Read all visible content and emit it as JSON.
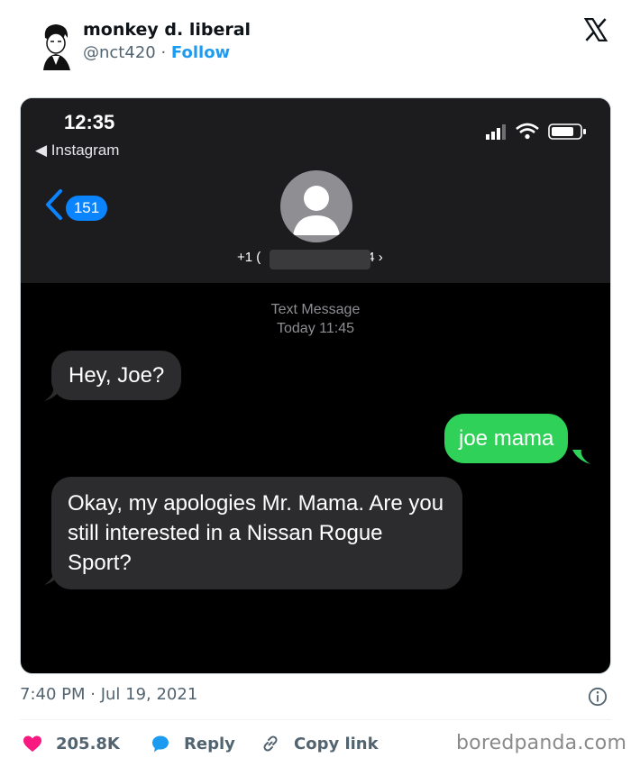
{
  "tweet": {
    "author": {
      "name": "monkey d. liberal",
      "handle": "@nct420",
      "separator": "·",
      "follow_label": "Follow"
    },
    "timestamp": "7:40 PM · Jul 19, 2021",
    "actions": {
      "likes": "205.8K",
      "reply_label": "Reply",
      "copy_label": "Copy link"
    },
    "colors": {
      "like": "#f91880",
      "accent": "#1d9bf0"
    }
  },
  "screenshot": {
    "status_time": "12:35",
    "back_app": "◀ Instagram",
    "unread_count": "151",
    "contact_number_prefix": "+1 (",
    "contact_number_suffix": "4 ›",
    "thread_label": "Text Message",
    "thread_time": "Today 11:45",
    "messages": [
      {
        "from": "them",
        "text": "Hey, Joe?"
      },
      {
        "from": "me",
        "text": "joe mama"
      },
      {
        "from": "them",
        "text": "Okay, my apologies Mr. Mama. Are you still interested in a Nissan Rogue Sport?"
      }
    ]
  },
  "watermark": "boredpanda.com"
}
